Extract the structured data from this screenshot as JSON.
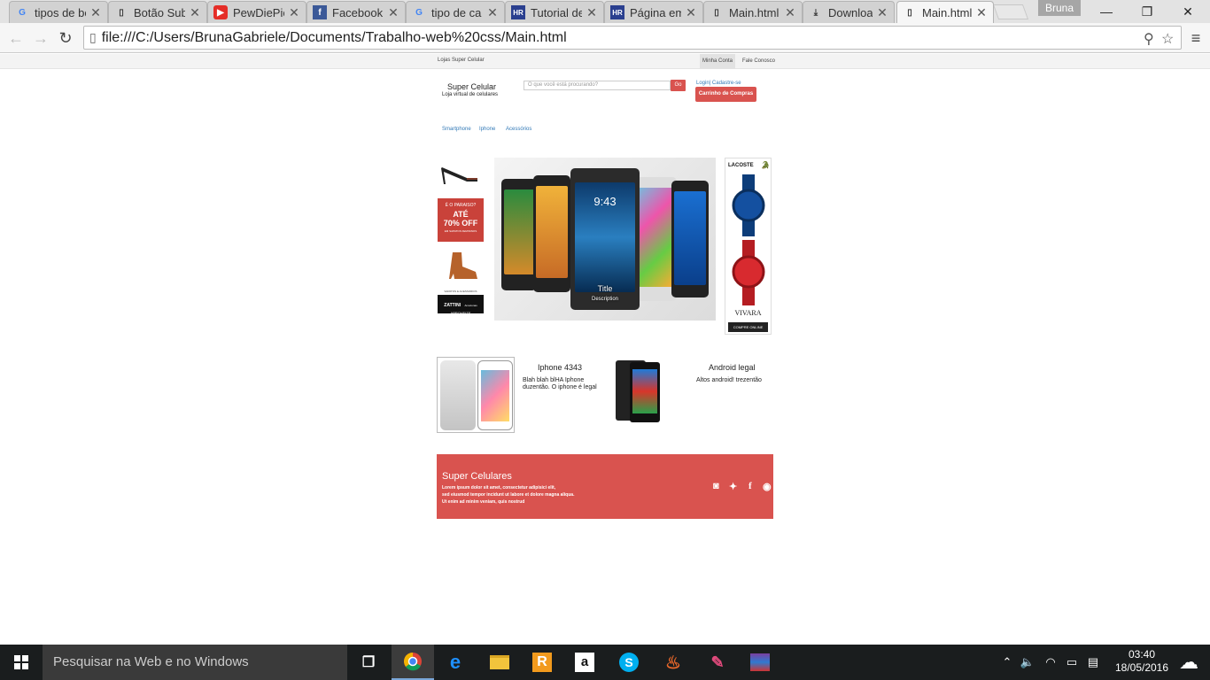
{
  "browser": {
    "tabs": [
      {
        "label": "tipos de bo",
        "icon": "google-icon"
      },
      {
        "label": "Botão Subi",
        "icon": "page-icon"
      },
      {
        "label": "PewDiePie",
        "icon": "youtube-icon"
      },
      {
        "label": "Facebook",
        "icon": "facebook-icon"
      },
      {
        "label": "tipo de ca",
        "icon": "google-icon"
      },
      {
        "label": "Tutorial de",
        "icon": "hr-icon"
      },
      {
        "label": "Página em",
        "icon": "hr-icon"
      },
      {
        "label": "Main.html",
        "icon": "page-icon"
      },
      {
        "label": "Download",
        "icon": "download-icon"
      },
      {
        "label": "Main.html",
        "icon": "page-icon",
        "active": true
      }
    ],
    "user": "Bruna",
    "url": "file:///C:/Users/BrunaGabriele/Documents/Trabalho-web%20css/Main.html"
  },
  "site": {
    "topbar": {
      "store": "Lojas Super Celular",
      "account": "Minha Conta",
      "contact": "Fale Conosco"
    },
    "logo": {
      "title": "Super Celular",
      "subtitle": "Loja virtual de celulares"
    },
    "search": {
      "placeholder": "O que você está procurando?",
      "button": "Go"
    },
    "login": "Login| Cadastre-se",
    "cart": "Carrinho de Compras",
    "categories": [
      "Smartphone",
      "Iphone",
      "Acessórios"
    ],
    "left_ads": {
      "paraiso": "É O PARAISO?",
      "ate": "ATÉ",
      "off": "70% OFF",
      "small": "EM SAPATOS FEMININOS",
      "zattini_top": "SAPATOS E ACESSORIOS",
      "zattini": "ZATTINI",
      "zattini_tag": "Amazonas",
      "aproveite": "APROVEITE"
    },
    "carousel": {
      "time": "9:43",
      "title": "Title",
      "description": "Description"
    },
    "right_ad": {
      "brand": "LACOSTE",
      "store": "VIVARA",
      "cta": "COMPRE ONLINE"
    },
    "products": [
      {
        "title": "Iphone 4343",
        "text": "Blah blah blHA Iphone duzentão. O iphone é legal"
      },
      {
        "title": "Android legal",
        "text": "Altos android! trezentão"
      }
    ],
    "footer": {
      "title": "Super Celulares",
      "lines": [
        "Lorem ipsum dolor sit amet, consectetur adipisici elit,",
        "sed eiusmod tempor incidunt ut labore et dolore magna aliqua.",
        "Ut enim ad minim veniam, quis nostrud"
      ],
      "social": [
        "instagram-icon",
        "twitter-icon",
        "facebook-icon",
        "github-icon"
      ]
    }
  },
  "taskbar": {
    "search_placeholder": "Pesquisar na Web e no Windows",
    "time": "03:40",
    "date": "18/05/2016"
  },
  "colors": {
    "accent": "#d9534f",
    "link": "#337ab7"
  }
}
